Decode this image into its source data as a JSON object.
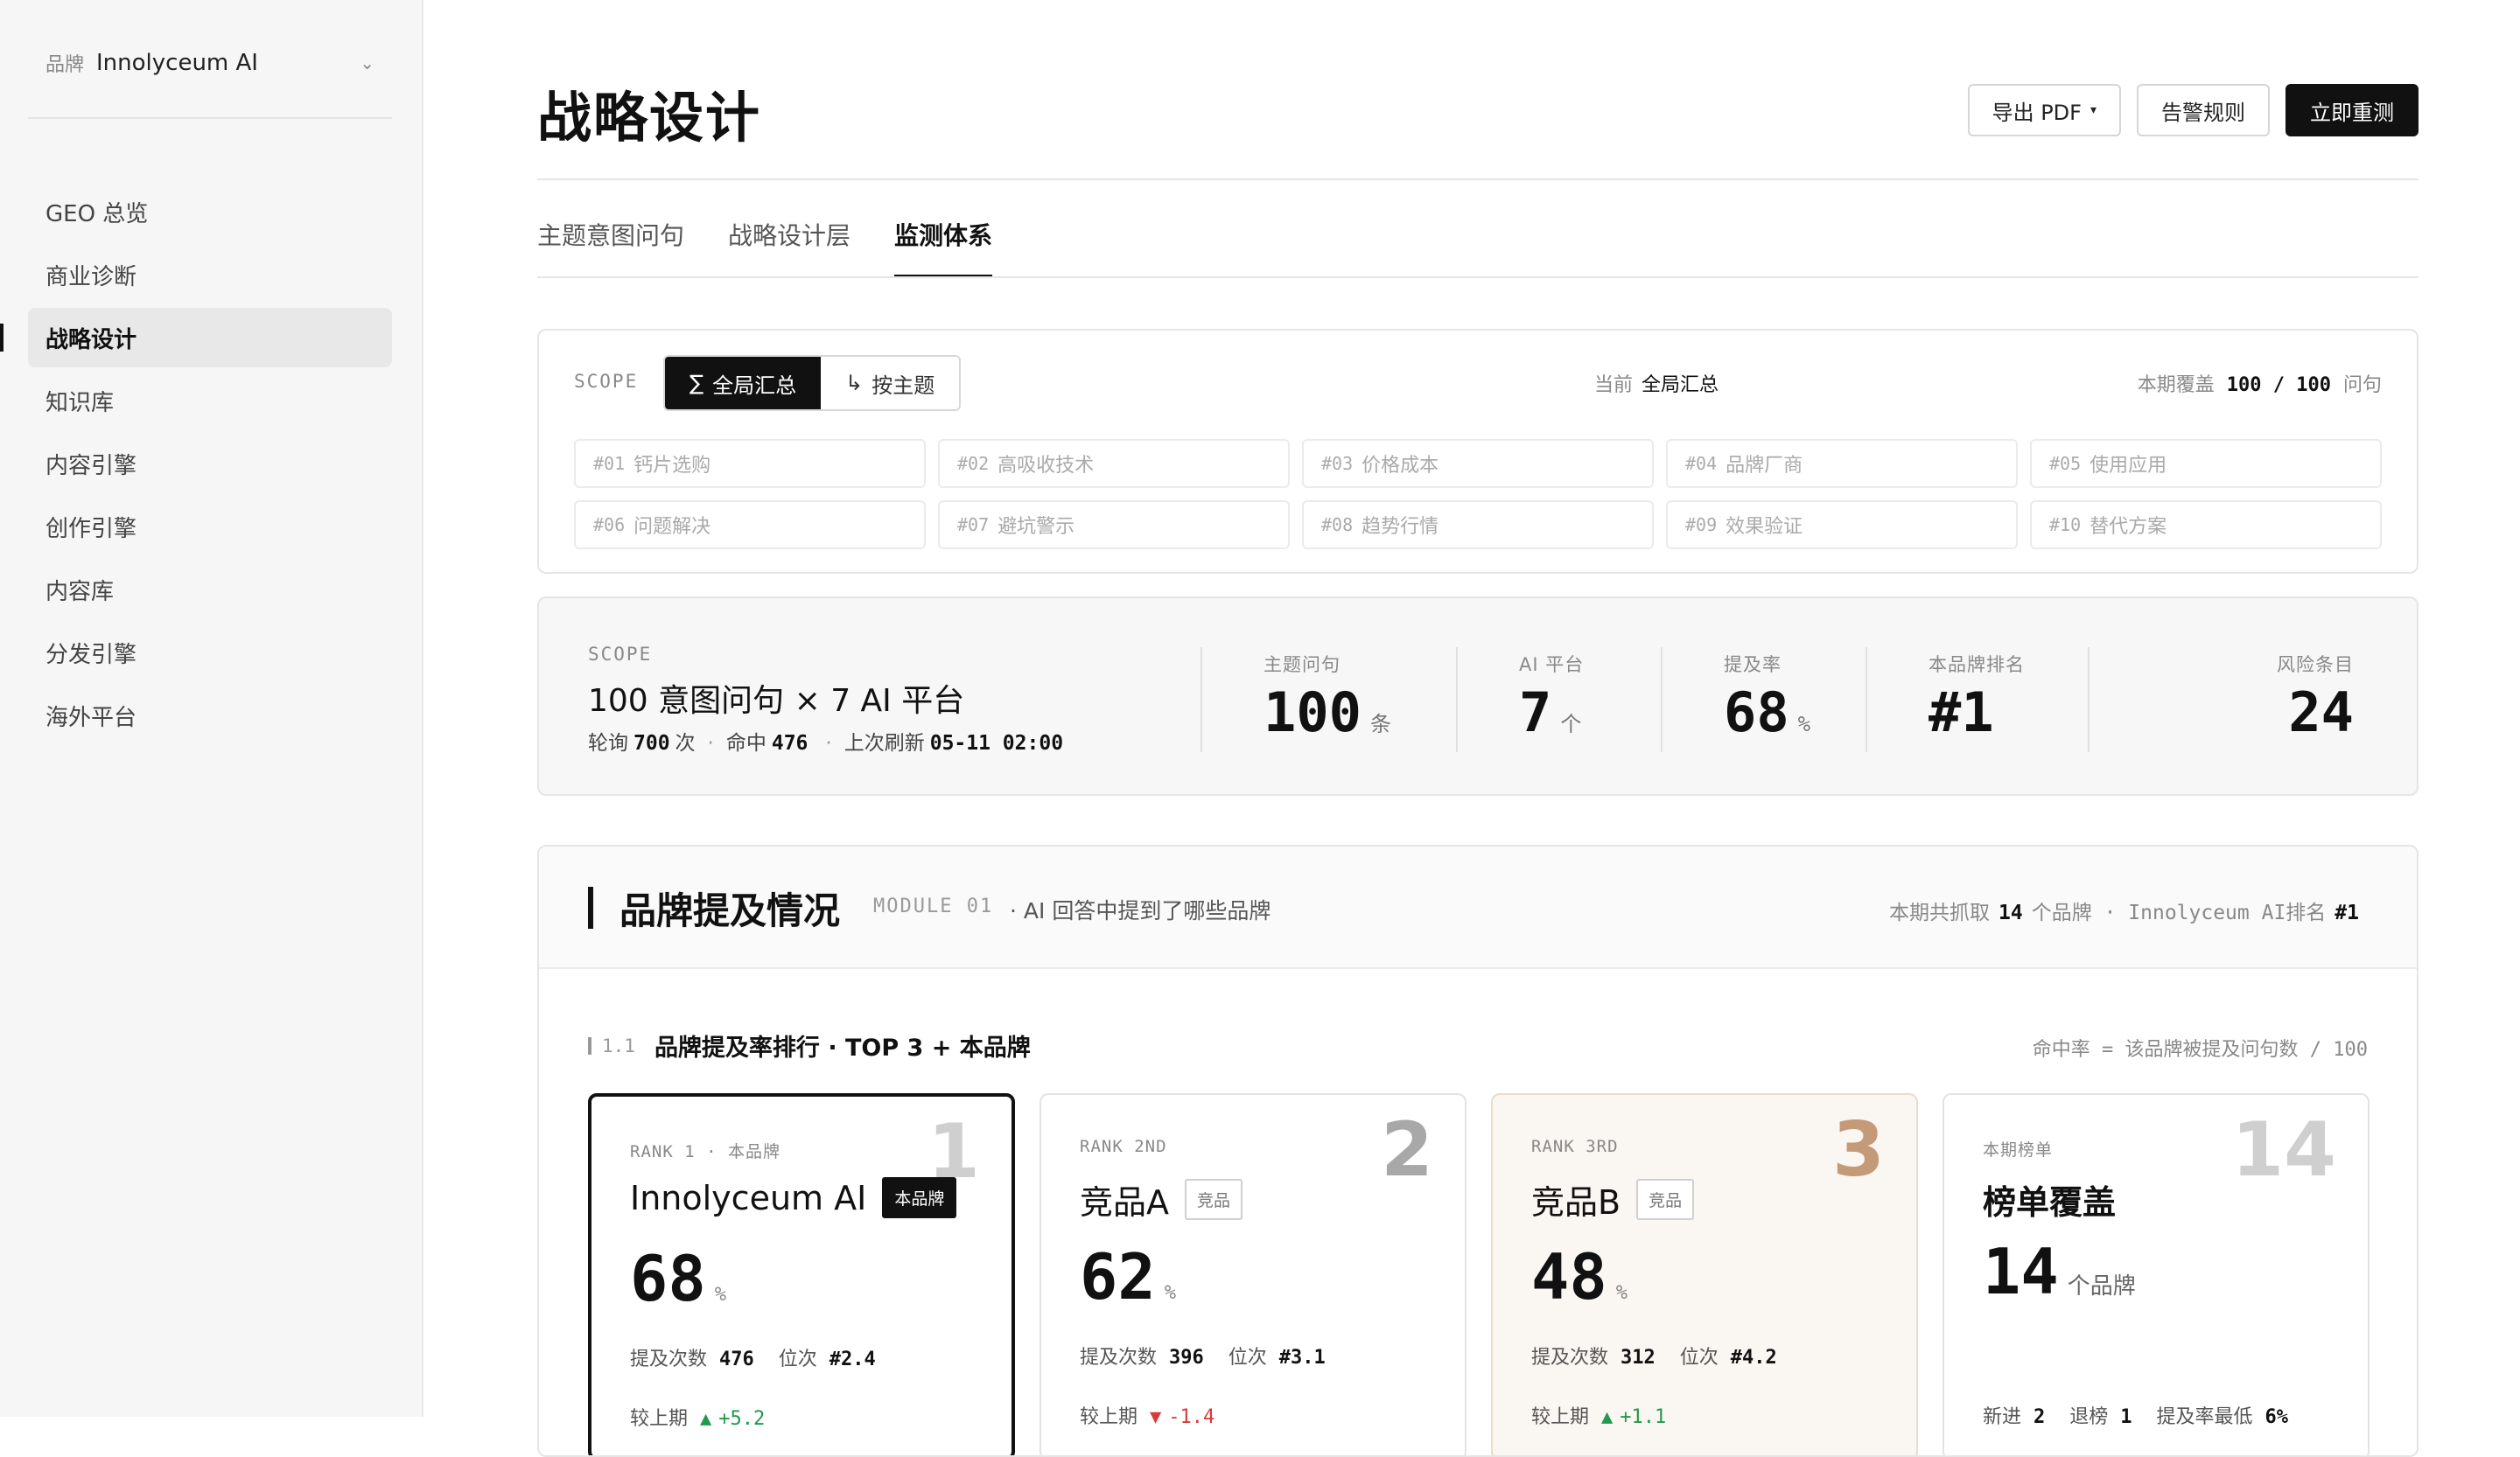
{
  "sidebar": {
    "brand_label": "品牌",
    "brand_name": "Innolyceum AI",
    "chevron": "⌄",
    "items": [
      {
        "label": "GEO 总览"
      },
      {
        "label": "商业诊断"
      },
      {
        "label": "战略设计"
      },
      {
        "label": "知识库"
      },
      {
        "label": "内容引擎"
      },
      {
        "label": "创作引擎"
      },
      {
        "label": "内容库"
      },
      {
        "label": "分发引擎"
      },
      {
        "label": "海外平台"
      }
    ],
    "active_index": 2
  },
  "header": {
    "title": "战略设计",
    "export_label": "导出 PDF",
    "export_caret": "▾",
    "alert_label": "告警规则",
    "retest_label": "立即重测"
  },
  "tabs": [
    {
      "label": "主题意图问句"
    },
    {
      "label": "战略设计层"
    },
    {
      "label": "监测体系"
    }
  ],
  "active_tab": 2,
  "scope": {
    "label": "SCOPE",
    "global_icon": "∑",
    "global_label": "全局汇总",
    "topic_icon": "↳",
    "topic_label": "按主题",
    "current_label": "当前",
    "current_value": "全局汇总",
    "coverage_label": "本期覆盖",
    "coverage_value": "100 / 100",
    "coverage_unit": "问句",
    "topics": [
      {
        "num": "#01",
        "name": "钙片选购"
      },
      {
        "num": "#02",
        "name": "高吸收技术"
      },
      {
        "num": "#03",
        "name": "价格成本"
      },
      {
        "num": "#04",
        "name": "品牌厂商"
      },
      {
        "num": "#05",
        "name": "使用应用"
      },
      {
        "num": "#06",
        "name": "问题解决"
      },
      {
        "num": "#07",
        "name": "避坑警示"
      },
      {
        "num": "#08",
        "name": "趋势行情"
      },
      {
        "num": "#09",
        "name": "效果验证"
      },
      {
        "num": "#10",
        "name": "替代方案"
      }
    ]
  },
  "stats": {
    "scope_label": "SCOPE",
    "title": "100 意图问句 × 7 AI 平台",
    "poll_label": "轮询",
    "poll_value": "700",
    "poll_unit": "次",
    "dot": "·",
    "hit_label": "命中",
    "hit_value": "476",
    "refresh_label": "上次刷新",
    "refresh_value": "05-11 02:00",
    "metrics": [
      {
        "label": "主题问句",
        "value": "100",
        "unit": "条"
      },
      {
        "label": "AI 平台",
        "value": "7",
        "unit": "个"
      },
      {
        "label": "提及率",
        "value": "68",
        "unit": "%"
      },
      {
        "label": "本品牌排名",
        "value": "#1",
        "unit": ""
      },
      {
        "label": "风险条目",
        "value": "24",
        "unit": ""
      }
    ]
  },
  "module": {
    "title": "品牌提及情况",
    "code": "MODULE 01",
    "desc": "· AI 回答中提到了哪些品牌",
    "right_prefix": "本期共抓取",
    "right_count": "14",
    "right_mid": "个品牌 · Innolyceum AI排名",
    "right_rank": "#1",
    "sub_num": "1.1",
    "sub_title": "品牌提及率排行 · TOP 3 + 本品牌",
    "sub_note": "命中率 = 该品牌被提及问句数 / 100",
    "cards": [
      {
        "label": "RANK 1 · 本品牌",
        "big": "1",
        "name": "Innolyceum AI",
        "tag": "本品牌",
        "value": "68",
        "unit": "%",
        "mentions_label": "提及次数",
        "mentions": "476",
        "pos_label": "位次",
        "pos": "#2.4",
        "delta_label": "较上期",
        "arrow": "▲",
        "delta": "+5.2"
      },
      {
        "label": "RANK 2ND",
        "big": "2",
        "name": "竞品A",
        "tag": "竞品",
        "value": "62",
        "unit": "%",
        "mentions_label": "提及次数",
        "mentions": "396",
        "pos_label": "位次",
        "pos": "#3.1",
        "delta_label": "较上期",
        "arrow": "▼",
        "delta": "-1.4"
      },
      {
        "label": "RANK 3RD",
        "big": "3",
        "name": "竞品B",
        "tag": "竞品",
        "value": "48",
        "unit": "%",
        "mentions_label": "提及次数",
        "mentions": "312",
        "pos_label": "位次",
        "pos": "#4.2",
        "delta_label": "较上期",
        "arrow": "▲",
        "delta": "+1.1"
      },
      {
        "label": "本期榜单",
        "big": "14",
        "name": "榜单覆盖",
        "value": "14",
        "unit": "个品牌",
        "new_label": "新进",
        "new_value": "2",
        "out_label": "退榜",
        "out_value": "1",
        "min_label": "提及率最低",
        "min_value": "6%"
      }
    ]
  },
  "colors": {
    "accent": "#111111",
    "up": "#1e9a4a",
    "down": "#d93a3a",
    "bronze": "#c49a78"
  }
}
